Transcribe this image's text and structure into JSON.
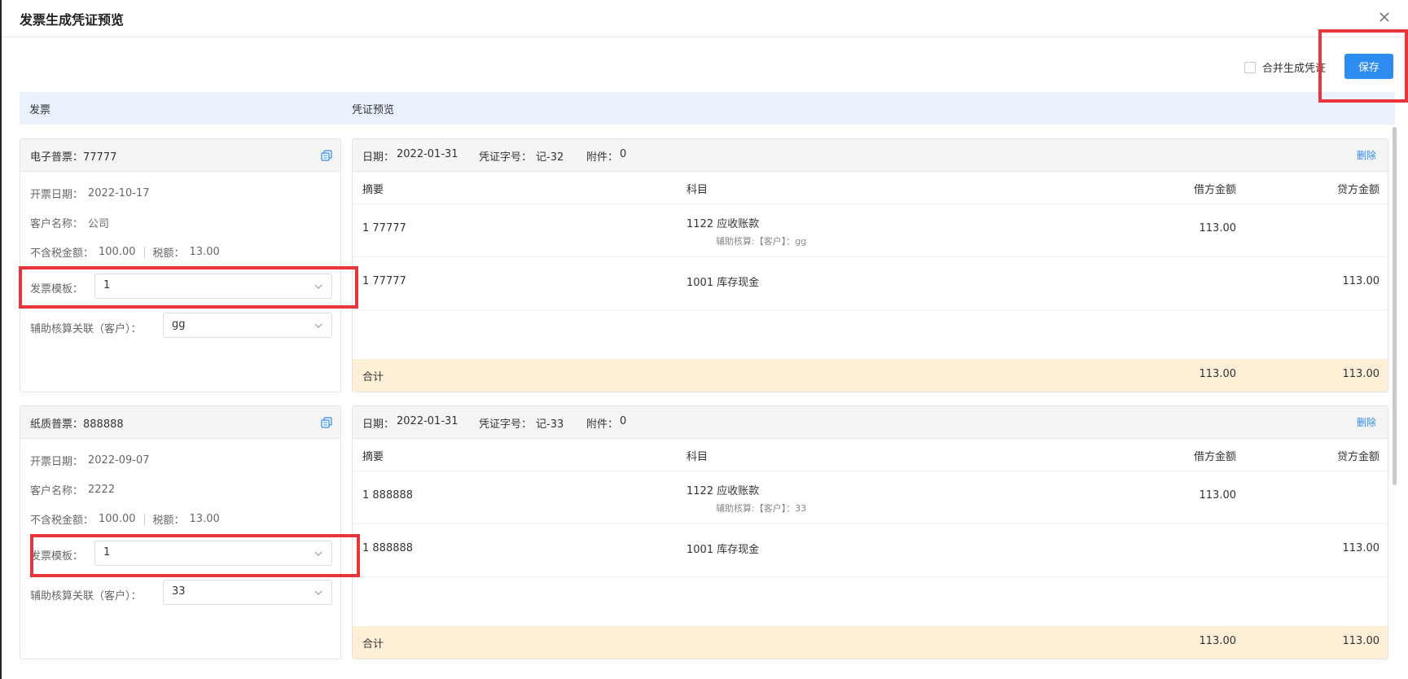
{
  "dialog": {
    "title": "发票生成凭证预览",
    "merge_label": "合并生成凭证",
    "save_label": "保存"
  },
  "sections": {
    "invoice_header": "发票",
    "voucher_header": "凭证预览"
  },
  "labels": {
    "issue_date": "开票日期：",
    "customer_name": "客户名称：",
    "pre_tax": "不含税金额：",
    "tax": "税额：",
    "template": "发票模板：",
    "aux_link": "辅助核算关联（客户）：",
    "date": "日期：",
    "voucher_no": "凭证字号：",
    "attachment": "附件：",
    "delete": "删除",
    "col_summary": "摘要",
    "col_account": "科目",
    "col_debit": "借方金额",
    "col_credit": "贷方金额",
    "total": "合计"
  },
  "items": [
    {
      "invoice_title": "电子普票：77777",
      "issue_date": "2022-10-17",
      "customer": "公司",
      "pre_tax": "100.00",
      "tax": "13.00",
      "template_value": "1",
      "aux_value": "gg",
      "voucher": {
        "date": "2022-01-31",
        "number": "记-32",
        "attachments": "0",
        "rows": [
          {
            "summary": "1 77777",
            "account": "1122 应收账款",
            "aux": "辅助核算:【客户】：gg",
            "debit": "113.00",
            "credit": ""
          },
          {
            "summary": "1 77777",
            "account": "1001 库存现金",
            "aux": "",
            "debit": "",
            "credit": "113.00"
          }
        ],
        "total_debit": "113.00",
        "total_credit": "113.00"
      }
    },
    {
      "invoice_title": "纸质普票：888888",
      "issue_date": "2022-09-07",
      "customer": "2222",
      "pre_tax": "100.00",
      "tax": "13.00",
      "template_value": "1",
      "aux_value": "33",
      "voucher": {
        "date": "2022-01-31",
        "number": "记-33",
        "attachments": "0",
        "rows": [
          {
            "summary": "1 888888",
            "account": "1122 应收账款",
            "aux": "辅助核算:【客户】：33",
            "debit": "113.00",
            "credit": ""
          },
          {
            "summary": "1 888888",
            "account": "1001 库存现金",
            "aux": "",
            "debit": "",
            "credit": "113.00"
          }
        ],
        "total_debit": "113.00",
        "total_credit": "113.00"
      }
    }
  ],
  "colors": {
    "accent": "#2d8cf0",
    "highlight": "#e8343a",
    "total_bg": "#fdf0d7",
    "section_bg": "#eaf3fd"
  }
}
